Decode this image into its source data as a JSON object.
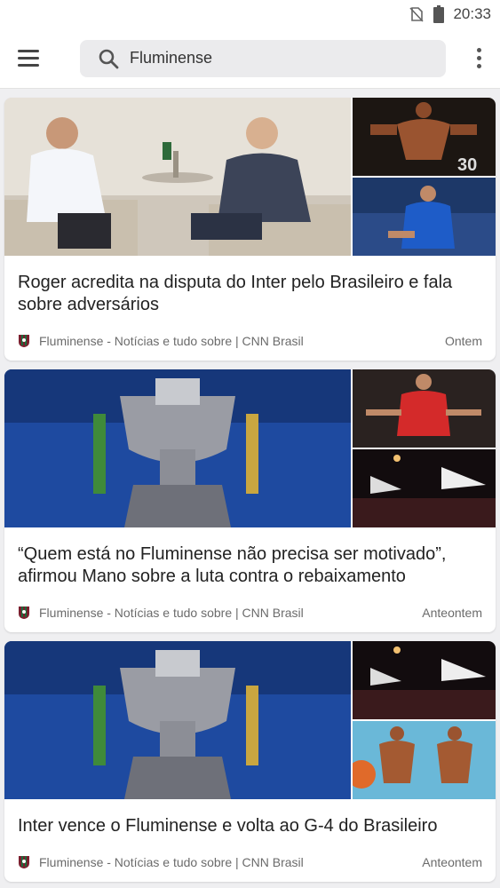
{
  "status": {
    "time": "20:33"
  },
  "search": {
    "query": "Fluminense"
  },
  "articles": [
    {
      "headline": "Roger acredita na disputa do Inter pelo Brasileiro e fala sobre adversários",
      "source": "Fluminense - Notícias e tudo sobre | CNN Brasil",
      "date": "Ontem"
    },
    {
      "headline": "“Quem está no Fluminense não precisa ser motivado”, afirmou Mano sobre a luta contra o rebaixamento",
      "source": "Fluminense - Notícias e tudo sobre | CNN Brasil",
      "date": "Anteontem"
    },
    {
      "headline": "Inter vence o Fluminense e volta ao G-4 do Brasileiro",
      "source": "Fluminense - Notícias e tudo sobre | CNN Brasil",
      "date": "Anteontem"
    }
  ]
}
